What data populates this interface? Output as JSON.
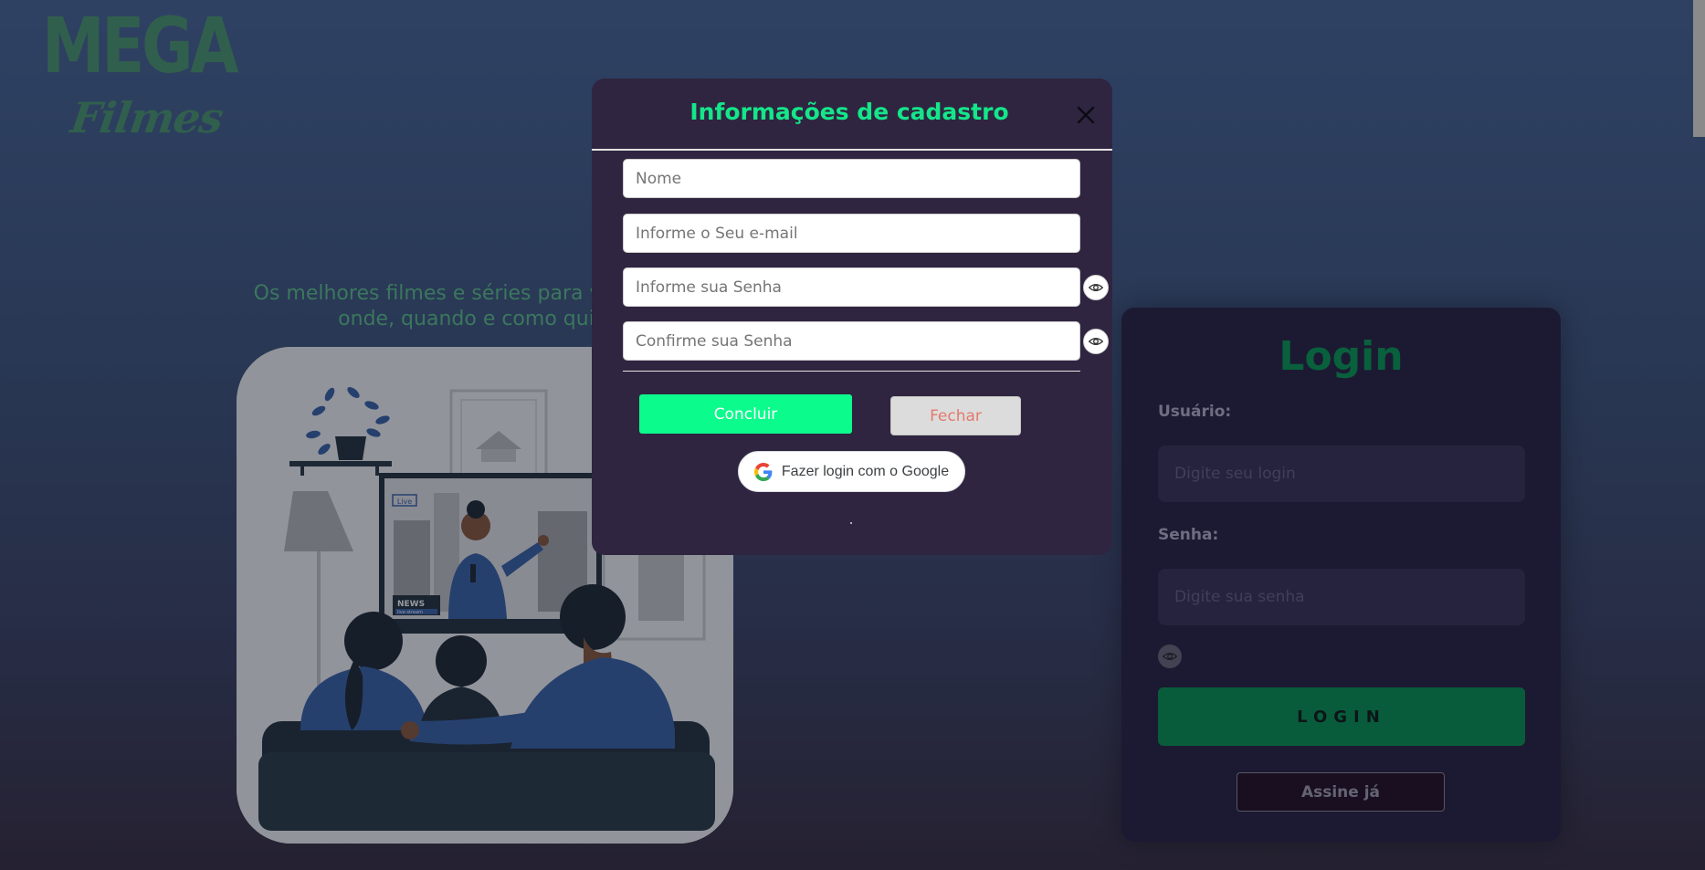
{
  "brand": {
    "line1": "MEGA",
    "line2": "Filmes",
    "color": "#4f9a6e"
  },
  "hero": {
    "tagline": "Os melhores filmes e séries para você assistir onde, quando e como quiser."
  },
  "illustration": {
    "tv_badge": "Live",
    "tv_news": "NEWS",
    "tv_stream": "live stream"
  },
  "login": {
    "title": "Login",
    "user_label": "Usuário:",
    "user_placeholder": "Digite seu login",
    "pass_label": "Senha:",
    "pass_placeholder": "Digite sua senha",
    "show_password_icon": "eye-icon",
    "login_button": "LOGIN",
    "subscribe_button": "Assine já"
  },
  "modal": {
    "title": "Informações de cadastro",
    "close_icon": "close-icon",
    "name_placeholder": "Nome",
    "email_placeholder": "Informe o Seu e-mail",
    "password_placeholder": "Informe sua Senha",
    "confirm_placeholder": "Confirme sua Senha",
    "submit_label": "Concluir",
    "close_label": "Fechar",
    "google_label": "Fazer login com o Google"
  },
  "colors": {
    "accent_green": "#14e68a",
    "submit_green": "#0bfc8c",
    "login_green": "#0a9550",
    "modal_bg": "#2f2540"
  }
}
